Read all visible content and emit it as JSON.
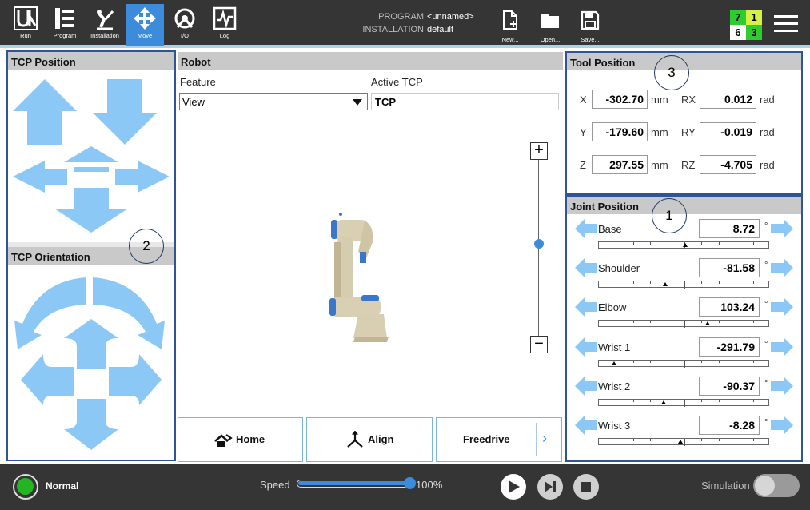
{
  "nav": [
    {
      "label": "Run",
      "icon": "ur-logo-icon"
    },
    {
      "label": "Program",
      "icon": "program-icon"
    },
    {
      "label": "Installation",
      "icon": "installation-icon"
    },
    {
      "label": "Move",
      "icon": "move-icon",
      "active": true
    },
    {
      "label": "I/O",
      "icon": "io-icon"
    },
    {
      "label": "Log",
      "icon": "log-icon"
    }
  ],
  "program": {
    "program_key": "PROGRAM",
    "program_value": "<unnamed>",
    "installation_key": "INSTALLATION",
    "installation_value": "default"
  },
  "file": {
    "new": "New...",
    "open": "Open...",
    "save": "Save..."
  },
  "counters": [
    "7",
    "1",
    "6",
    "3"
  ],
  "tcp_position": {
    "title": "TCP Position"
  },
  "tcp_orientation": {
    "title": "TCP Orientation"
  },
  "robot": {
    "title": "Robot",
    "feature_label": "Feature",
    "feature_value": "View",
    "active_tcp_label": "Active TCP",
    "active_tcp_value": "TCP",
    "zoom_in": "+",
    "zoom_out": "−",
    "home": "Home",
    "align": "Align",
    "freedrive": "Freedrive",
    "more": "›"
  },
  "tool_position": {
    "title": "Tool Position",
    "rows": [
      {
        "axis": "X",
        "value": "-302.70",
        "unit": "mm",
        "raxis": "RX",
        "rvalue": "0.012",
        "runit": "rad"
      },
      {
        "axis": "Y",
        "value": "-179.60",
        "unit": "mm",
        "raxis": "RY",
        "rvalue": "-0.019",
        "runit": "rad"
      },
      {
        "axis": "Z",
        "value": "297.55",
        "unit": "mm",
        "raxis": "RZ",
        "rvalue": "-4.705",
        "runit": "rad"
      }
    ]
  },
  "joint_position": {
    "title": "Joint Position",
    "deg": "°",
    "joints": [
      {
        "name": "Base",
        "value": "8.72",
        "level": 0.51
      },
      {
        "name": "Shoulder",
        "value": "-81.58",
        "level": 0.39
      },
      {
        "name": "Elbow",
        "value": "103.24",
        "level": 0.64
      },
      {
        "name": "Wrist 1",
        "value": "-291.79",
        "level": 0.09
      },
      {
        "name": "Wrist 2",
        "value": "-90.37",
        "level": 0.38
      },
      {
        "name": "Wrist 3",
        "value": "-8.28",
        "level": 0.48
      }
    ]
  },
  "annotations": [
    "1",
    "2",
    "3"
  ],
  "footer": {
    "status": "Normal",
    "speed_label": "Speed",
    "speed_value": "100%",
    "speed_level": 1.0,
    "simulation_label": "Simulation"
  },
  "colors": {
    "accent": "#3c8cdb",
    "arrow": "#8cc8f5",
    "status_green": "#23b523",
    "annotation_outline": "#2f5597"
  }
}
